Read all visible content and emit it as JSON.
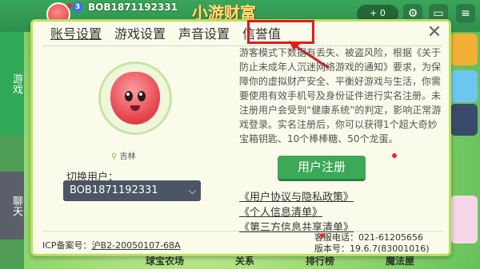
{
  "topbar": {
    "level": "3",
    "username": "BOB1871192331",
    "logo_text": "小游财富",
    "gems": "+ 0",
    "icons": [
      "plus-icon",
      "gear-icon",
      "tv-icon",
      "menu-icon"
    ]
  },
  "left_rail": {
    "game_tab": "游戏",
    "chat_tab": "聊天"
  },
  "bottom_nav": [
    "球宝农场",
    "关系",
    "排行榜",
    "魔法屋"
  ],
  "dialog": {
    "tabs": [
      {
        "label": "账号设置",
        "active": true
      },
      {
        "label": "游戏设置",
        "active": false
      },
      {
        "label": "声音设置",
        "active": false
      },
      {
        "label": "信誉值",
        "active": false
      }
    ],
    "close": "✕",
    "location": "吉林",
    "switch_user_label": "切换用户：",
    "selected_user": "BOB1871192331",
    "notice": "游客模式下数据有丢失、被盗风险，根据《关于防止未成年人沉迷网络游戏的通知》要求，为保障你的虚拟财产安全、平衡好游戏与生活，你需要使用有效手机号及身份证件进行实名注册。未注册用户会受到“健康系统”的判定，影响正常游戏登录。实名注册后，你可以获得1个超大奇妙宝箱钥匙、10个棒棒糖、50个龙蛋。",
    "register_button": "用户注册",
    "links": [
      "《用户协议与隐私政策》",
      "《个人信息清单》",
      "《第三方信息共享清单》"
    ],
    "icp_label": "ICP备案号：",
    "icp_number": "沪B2-20050107-68A",
    "phone": "客服电话：021-61205656",
    "version": "版本号：19.6.7(83001016)"
  },
  "colors": {
    "accent_green": "#3ba957",
    "highlight_red": "#e11a1a",
    "dialog_border": "#b9e05c"
  }
}
